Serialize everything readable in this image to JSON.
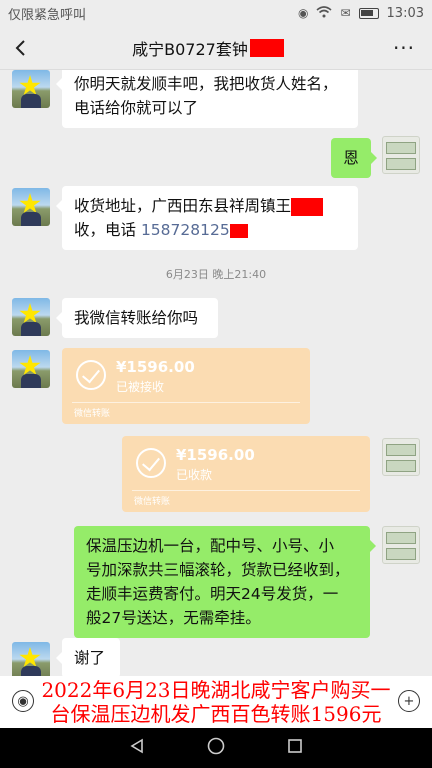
{
  "status_bar": {
    "carrier": "仅限紧急呼叫",
    "time": "13:03"
  },
  "header": {
    "title": "咸宁B0727套钟",
    "back_icon": "chevron-left-icon",
    "more_icon": "more-dots-icon",
    "more_label": "···"
  },
  "messages": [
    {
      "side": "left",
      "text_lines": [
        "你明天就发顺丰吧，我把收货人姓名，",
        "电话给你就可以了"
      ]
    },
    {
      "side": "right",
      "text": "恩"
    },
    {
      "side": "left",
      "text_prefix": "收货地址，广西田东县祥周镇王",
      "text_line2": "收，电话 ",
      "phone": "158728125"
    },
    {
      "timestamp": "6月23日 晚上21:40"
    },
    {
      "side": "left",
      "text": "我微信转账给你吗"
    },
    {
      "side": "left",
      "transfer": {
        "amount": "¥1596.00",
        "status": "已被接收",
        "source": "微信转账"
      }
    },
    {
      "side": "right",
      "transfer": {
        "amount": "¥1596.00",
        "status": "已收款",
        "source": "微信转账"
      }
    },
    {
      "side": "right",
      "text_lines": [
        "保温压边机一台，配中号、小号、小",
        "号加深款共三幅滚轮，货款已经收到，",
        "走顺丰运费寄付。明天24号发货，一",
        "般27号送达，无需牵挂。"
      ]
    },
    {
      "side": "left",
      "text": "谢了"
    }
  ],
  "caption": {
    "line1": "2022年6月23日晚湖北咸宁客户购买一",
    "line2": "台保温压边机发广西百色转账1596元"
  },
  "colors": {
    "background": "#ededed",
    "bubble_left": "#ffffff",
    "bubble_right": "#95ec69",
    "transfer_card": "#fbdcb2",
    "redaction": "#ff0000",
    "caption_text": "#ff0000"
  }
}
